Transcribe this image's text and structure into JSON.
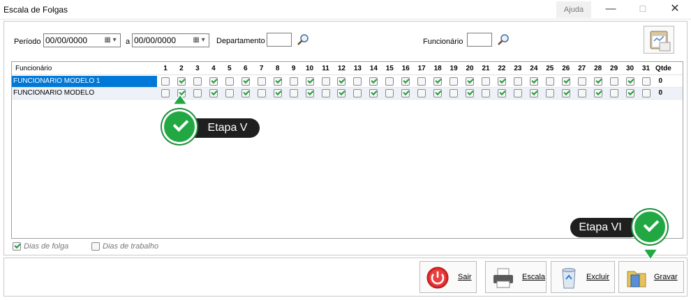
{
  "window": {
    "title": "Escala de Folgas",
    "help_label": "Ajuda",
    "minimize_glyph": "—",
    "maximize_glyph": "☐",
    "close_glyph": "✕"
  },
  "filters": {
    "periodo_label": "Período",
    "periodo_inicio": "00/00/0000",
    "a_label": "a",
    "periodo_fim": "00/00/0000",
    "departamento_label": "Departamento",
    "departamento_value": "",
    "funcionario_label": "Funcionário",
    "funcionario_value": ""
  },
  "grid": {
    "name_header": "Funcionário",
    "qtde_header": "Qtde",
    "days": [
      "1",
      "2",
      "3",
      "4",
      "5",
      "6",
      "7",
      "8",
      "9",
      "10",
      "11",
      "12",
      "13",
      "14",
      "15",
      "16",
      "17",
      "18",
      "19",
      "20",
      "21",
      "22",
      "23",
      "24",
      "25",
      "26",
      "27",
      "28",
      "29",
      "30",
      "31"
    ],
    "rows": [
      {
        "name": "FUNCIONARIO MODELO 1",
        "qtde": "0",
        "selected": true,
        "checked": [
          false,
          true,
          false,
          true,
          false,
          true,
          false,
          true,
          false,
          true,
          false,
          true,
          false,
          true,
          false,
          true,
          false,
          true,
          false,
          true,
          false,
          true,
          false,
          true,
          false,
          true,
          false,
          true,
          false,
          true,
          false
        ]
      },
      {
        "name": "FUNCIONARIO MODELO",
        "qtde": "0",
        "selected": false,
        "checked": [
          false,
          true,
          false,
          true,
          false,
          true,
          false,
          true,
          false,
          true,
          false,
          true,
          false,
          true,
          false,
          true,
          false,
          true,
          false,
          true,
          false,
          true,
          false,
          true,
          false,
          true,
          false,
          true,
          false,
          true,
          false
        ]
      }
    ]
  },
  "legend": {
    "folga_label": "Dias de folga",
    "trabalho_label": "Dias de trabalho"
  },
  "actions": {
    "sair": "Sair",
    "escala": "Escala",
    "excluir": "Excluir",
    "gravar": "Gravar"
  },
  "callouts": {
    "step5": "Etapa V",
    "step6": "Etapa VI"
  },
  "colors": {
    "selection": "#0078d7",
    "check_green": "#1e9c3c",
    "callout_green": "#21a843",
    "callout_dark": "#1f1f1f"
  }
}
